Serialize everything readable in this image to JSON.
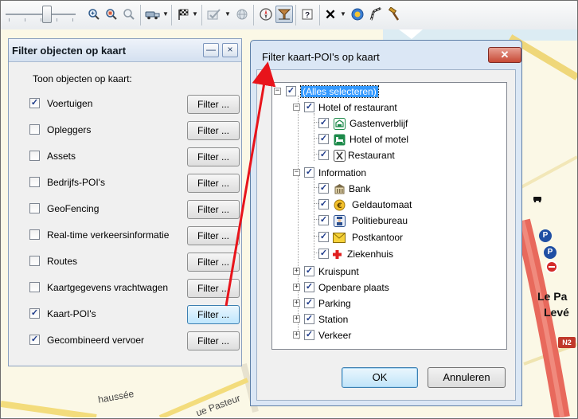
{
  "toolbar": {
    "icons": [
      "zoom-in-icon",
      "zoom-area-icon",
      "zoom-out-icon",
      "vehicle-icon",
      "checkered-flag-icon",
      "checkmark-tool-icon",
      "globe-icon",
      "compass-icon",
      "filter-icon",
      "help-icon",
      "close-x-icon",
      "info-icon",
      "route-icon",
      "hammer-icon"
    ]
  },
  "map_labels": {
    "city_1": "Le Pa",
    "city_2": "Levé",
    "road_badge": "N2",
    "street_1": "haussée",
    "street_2": "ue Pasteur"
  },
  "left_panel": {
    "title": "Filter objecten op kaart",
    "minimize_glyph": "—",
    "close_glyph": "×",
    "show_label": "Toon objecten op kaart:",
    "rows": [
      {
        "label": "Voertuigen",
        "checked": true,
        "button": "Filter ..."
      },
      {
        "label": "Opleggers",
        "checked": false,
        "button": "Filter ..."
      },
      {
        "label": "Assets",
        "checked": false,
        "button": "Filter ..."
      },
      {
        "label": "Bedrijfs-POI's",
        "checked": false,
        "button": "Filter ..."
      },
      {
        "label": "GeoFencing",
        "checked": false,
        "button": "Filter ..."
      },
      {
        "label": "Real-time verkeersinformatie",
        "checked": false,
        "button": "Filter ..."
      },
      {
        "label": "Routes",
        "checked": false,
        "button": "Filter ..."
      },
      {
        "label": "Kaartgegevens vrachtwagen",
        "checked": false,
        "button": "Filter ..."
      },
      {
        "label": "Kaart-POI's",
        "checked": true,
        "button": "Filter ..."
      },
      {
        "label": "Gecombineerd vervoer",
        "checked": true,
        "button": "Filter ..."
      }
    ]
  },
  "dialog": {
    "title": "Filter kaart-POI's op kaart",
    "close_glyph": "✕",
    "tree": {
      "root": "(Alles selecteren)",
      "hotel_group": "Hotel of restaurant",
      "hotel_items": [
        "Gastenverblijf",
        "Hotel of motel",
        "Restaurant"
      ],
      "info_group": "Information",
      "info_items": [
        "Bank",
        "Geldautomaat",
        "Politiebureau",
        "Postkantoor",
        "Ziekenhuis"
      ],
      "other_groups": [
        "Kruispunt",
        "Openbare plaats",
        "Parking",
        "Station",
        "Verkeer"
      ]
    },
    "ok_label": "OK",
    "cancel_label": "Annuleren"
  },
  "colors": {
    "map_bg": "#fbf8e6",
    "road_red": "#e8695c",
    "annotation_arrow": "#e8141b",
    "selection_blue": "#3399ff"
  }
}
